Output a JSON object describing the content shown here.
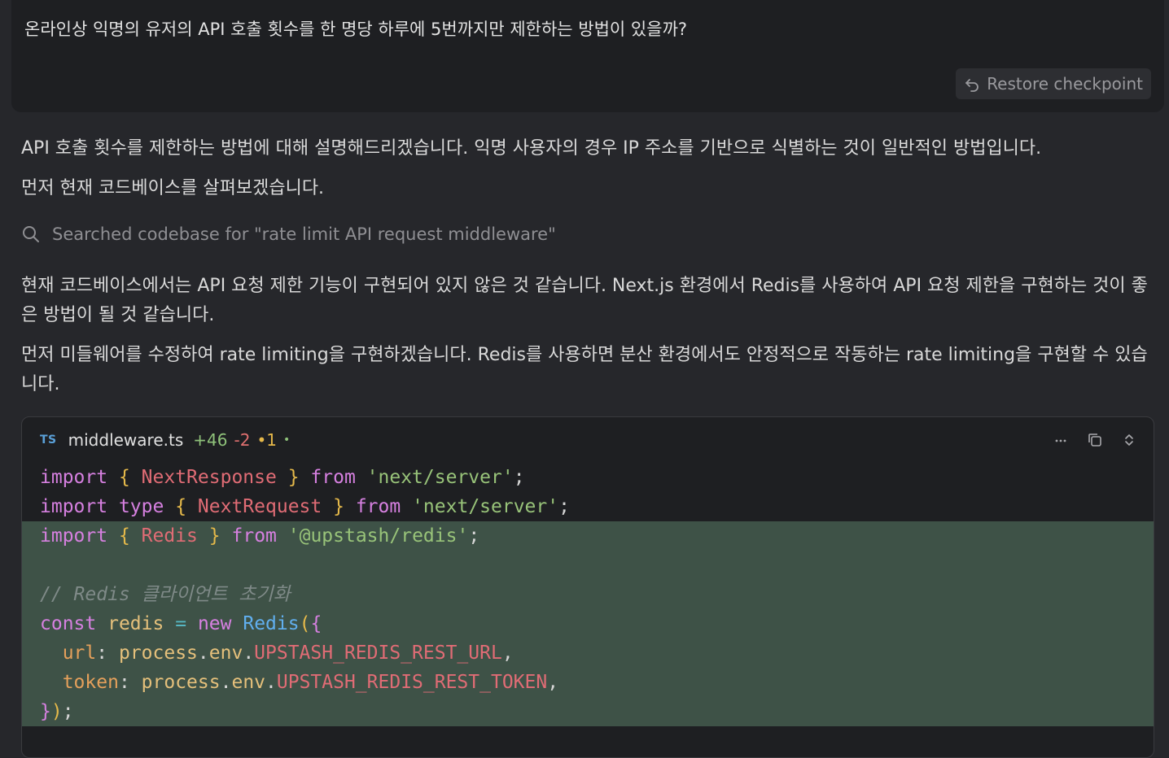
{
  "user_message": {
    "text": "온라인상 익명의 유저의 API 호출 횟수를 한 명당 하루에 5번까지만 제한하는 방법이 있을까?",
    "restore_label": "Restore checkpoint"
  },
  "assistant": {
    "para1": "API 호출 횟수를 제한하는 방법에 대해 설명해드리겠습니다. 익명 사용자의 경우 IP 주소를 기반으로 식별하는 것이 일반적인 방법입니다.",
    "para2": "먼저 현재 코드베이스를 살펴보겠습니다.",
    "search": "Searched codebase for \"rate limit API request middleware\"",
    "para3": "현재 코드베이스에서는 API 요청 제한 기능이 구현되어 있지 않은 것 같습니다. Next.js 환경에서 Redis를 사용하여 API 요청 제한을 구현하는 것이 좋은 방법이 될 것 같습니다.",
    "para4": "먼저 미들웨어를 수정하여 rate limiting을 구현하겠습니다. Redis를 사용하면 분산 환경에서도 안정적으로 작동하는 rate limiting을 구현할 수 있습니다."
  },
  "code_card": {
    "lang_badge": "TS",
    "filename": "middleware.ts",
    "additions": "+46",
    "deletions": "-2",
    "modified": "•1",
    "dot": "•",
    "more_icon": "more-icon",
    "copy_icon": "copy-icon",
    "expand_icon": "expand-icon",
    "line1": {
      "a": "import",
      "b": "{",
      "c": "NextResponse",
      "d": "}",
      "e": "from",
      "f": "'next/server'",
      "g": ";"
    },
    "line2": {
      "a": "import",
      "b": "type",
      "c": "{",
      "d": "NextRequest",
      "e": "}",
      "f": "from",
      "g": "'next/server'",
      "h": ";"
    },
    "line3": {
      "a": "import",
      "b": "{",
      "c": "Redis",
      "d": "}",
      "e": "from",
      "f": "'@upstash/redis'",
      "g": ";"
    },
    "line5": "// Redis 클라이언트 초기화",
    "line6": {
      "a": "const",
      "b": "redis",
      "c": "=",
      "d": "new",
      "e": "Redis",
      "f": "(",
      "g": "{"
    },
    "line7": {
      "a": "url",
      "b": ":",
      "c": "process",
      "d": ".",
      "e": "env",
      "f": ".",
      "g": "UPSTASH_REDIS_REST_URL",
      "h": ","
    },
    "line8": {
      "a": "token",
      "b": ":",
      "c": "process",
      "d": ".",
      "e": "env",
      "f": ".",
      "g": "UPSTASH_REDIS_REST_TOKEN",
      "h": ","
    },
    "line9": {
      "a": "}",
      "b": ")",
      "c": ";"
    }
  }
}
